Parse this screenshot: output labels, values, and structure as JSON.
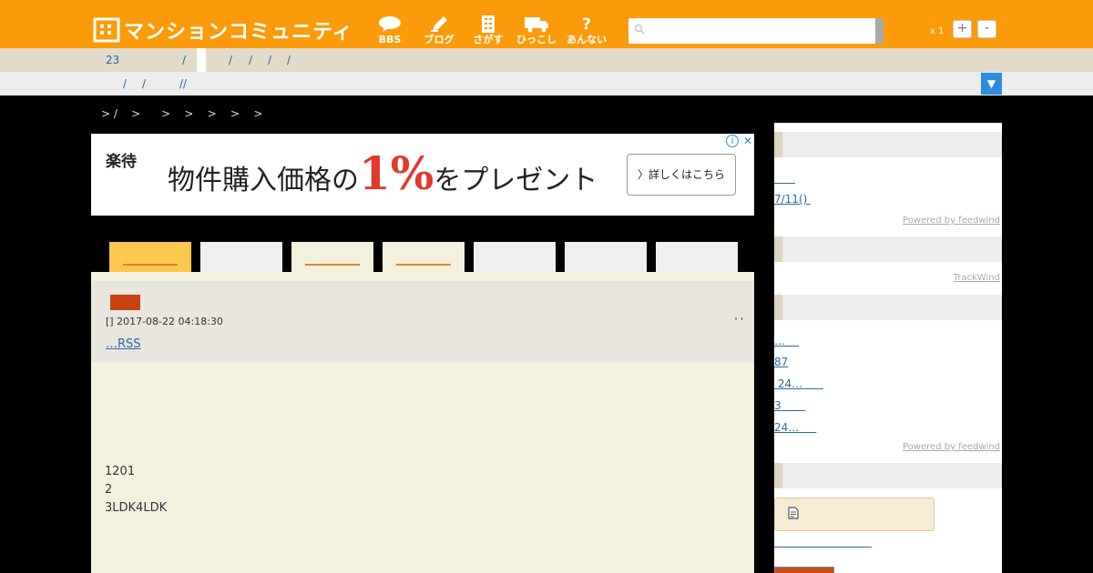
{
  "header": {
    "logo_text": "マンションコミュニティ",
    "nav": [
      {
        "label": "BBS",
        "icon": "speech-bubble-icon"
      },
      {
        "label": "ブログ",
        "icon": "pencil-icon"
      },
      {
        "label": "さがす",
        "icon": "building-icon"
      },
      {
        "label": "ひっこし",
        "icon": "truck-icon"
      },
      {
        "label": "あんない",
        "icon": "question-icon"
      }
    ],
    "search_placeholder": "",
    "zoom_label": "x 1",
    "zoom_in": "+",
    "zoom_out": "-"
  },
  "subnav1": {
    "items": [
      "23",
      "/",
      "/",
      "/",
      "/",
      "/"
    ]
  },
  "subnav2": {
    "items": [
      "/",
      "/",
      "//"
    ]
  },
  "dropdown_label": "▼",
  "breadcrumb": "> /    >      >    >    >    >    >",
  "ad": {
    "brand": "楽待",
    "headline_pre": "物件購入価格の",
    "headline_big": "1%",
    "headline_post": "をプレゼント",
    "cta": "〉詳しくはこちら",
    "info": "i",
    "close": "✕"
  },
  "tabs": [
    {
      "state": "active",
      "color": "#fdc850"
    },
    {
      "state": "plain",
      "color": "#efefef"
    },
    {
      "state": "underlined",
      "color": "#f3f0de"
    },
    {
      "state": "underlined",
      "color": "#f3f0de"
    },
    {
      "state": "plain",
      "color": "#efefef"
    },
    {
      "state": "plain",
      "color": "#efefef"
    },
    {
      "state": "plain",
      "color": "#efefef"
    }
  ],
  "post": {
    "meta": "[] 2017-08-22 04:18:30",
    "meta_right": "' '",
    "rss_prefix": "…",
    "rss_label": "RSS",
    "body": [
      "1201",
      "2",
      "3LDK4LDK"
    ]
  },
  "sidebar": {
    "section1_links": [
      "      ",
      "7/11() "
    ],
    "powered1": "Powered by feedwind",
    "trackwind": "TrackWind",
    "section3_links": [
      "…    ",
      "87",
      " 24…      ",
      "3       ",
      "24…     "
    ],
    "powered2": "Powered by feedwind",
    "doc_icon": "document-icon"
  }
}
